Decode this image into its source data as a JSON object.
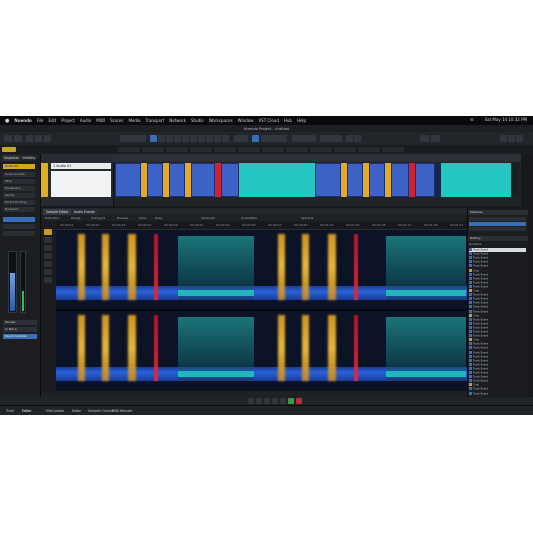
{
  "menu": {
    "app": "Nuendo",
    "items": [
      "File",
      "Edit",
      "Project",
      "Audio",
      "MIDI",
      "Scores",
      "Media",
      "Transport",
      "Network",
      "Studio",
      "Workspaces",
      "Window",
      "VST Cloud",
      "Hub",
      "Help"
    ],
    "clock": "Sat May 14  10:32 PM"
  },
  "window": {
    "title": "Nuendo Project - Untitled"
  },
  "left_zone": {
    "tabs": [
      "Inspector",
      "Visibility"
    ],
    "items": [
      "Audio 01",
      "Audio Inserts",
      "Strip",
      "Equalizers",
      "Sends",
      "Direct Routing",
      "Notepad"
    ],
    "buttons": [
      "Render",
      "In Place",
      "Quick Controls"
    ]
  },
  "track": {
    "name": "1  Audio 01"
  },
  "editor": {
    "tabs": [
      "Sample Editor",
      "Audio Events"
    ],
    "toolbar_items": [
      "Definition",
      "Range",
      "Transport",
      "Process",
      "Slice",
      "Drag",
      "VariAudio",
      "AudioWarp",
      "Spectral"
    ],
    "ruler_labels": [
      "00:00:41",
      "00:00:43",
      "00:00:45",
      "00:00:47",
      "00:00:49",
      "00:00:51",
      "00:00:53",
      "00:00:55",
      "00:00:57",
      "00:00:59",
      "00:01:01",
      "00:01:03",
      "00:01:05",
      "00:01:07",
      "00:01:09",
      "00:01:11",
      "00:01:13"
    ]
  },
  "right_zone": {
    "header_top": "Modules",
    "header_history": "History",
    "history_root": "Functions",
    "history_items": [
      "Track Event",
      "Track Event",
      "Track Event",
      "Track Event",
      "Track Event",
      "Crop",
      "Track Event",
      "Track Event",
      "Track Event",
      "Track Event",
      "Crop",
      "Track Event",
      "Track Event",
      "Track Event",
      "Track Event",
      "Track Event",
      "Crop",
      "Track Event",
      "Track Event",
      "Track Event",
      "Track Event",
      "Track Event",
      "Crop",
      "Track Event",
      "Track Event",
      "Track Event",
      "Track Event",
      "Track Event",
      "Track Event",
      "Track Event",
      "Track Event",
      "Track Event",
      "Track Event",
      "Crop",
      "Track Event",
      "Track Event"
    ],
    "selected_index": 0
  },
  "bottom": {
    "tabs": [
      "Track",
      "Editor",
      "MixConsole",
      "Editor",
      "Sampler Control",
      "MIDI Remote"
    ]
  },
  "colors": {
    "event_blue": "#3d63c7",
    "event_yellow": "#e3a92a",
    "event_red": "#cf2232",
    "event_teal": "#26c6c1",
    "track_color": "#e1ae22",
    "selection": "#3a6fb5"
  }
}
